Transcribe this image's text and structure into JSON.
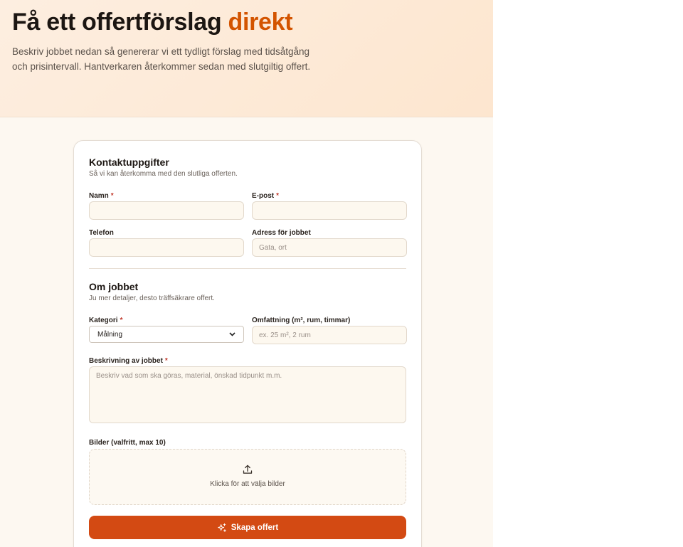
{
  "hero": {
    "title_main": "Få ett offertförslag",
    "title_accent": "direkt",
    "description": "Beskriv jobbet nedan så genererar vi ett tydligt förslag med tidsåtgång och prisintervall. Hantverkaren återkommer sedan med slutgiltig offert."
  },
  "contact": {
    "title": "Kontaktuppgifter",
    "subtitle": "Så vi kan återkomma med den slutliga offerten.",
    "name_label": "Namn",
    "email_label": "E-post",
    "phone_label": "Telefon",
    "address_label": "Adress för jobbet",
    "address_placeholder": "Gata, ort",
    "required_mark": "*",
    "name_value": "",
    "email_value": "",
    "phone_value": "",
    "address_value": ""
  },
  "job": {
    "title": "Om jobbet",
    "subtitle": "Ju mer detaljer, desto träffsäkrare offert.",
    "category_label": "Kategori",
    "category_selected": "Målning",
    "scope_label": "Omfattning (m², rum, timmar)",
    "scope_placeholder": "ex. 25 m², 2 rum",
    "description_label": "Beskrivning av jobbet",
    "description_placeholder": "Beskriv vad som ska göras, material, önskad tidpunkt m.m.",
    "images_label": "Bilder (valfritt, max 10)",
    "images_prompt": "Klicka för att välja bilder"
  },
  "actions": {
    "submit_label": "Skapa offert"
  },
  "colors": {
    "accent": "#d35400",
    "button": "#d34a13",
    "required": "#c0392b"
  },
  "icons": {
    "upload": "upload-icon",
    "submit": "sparkles-icon",
    "select": "chevron-down-icon"
  }
}
